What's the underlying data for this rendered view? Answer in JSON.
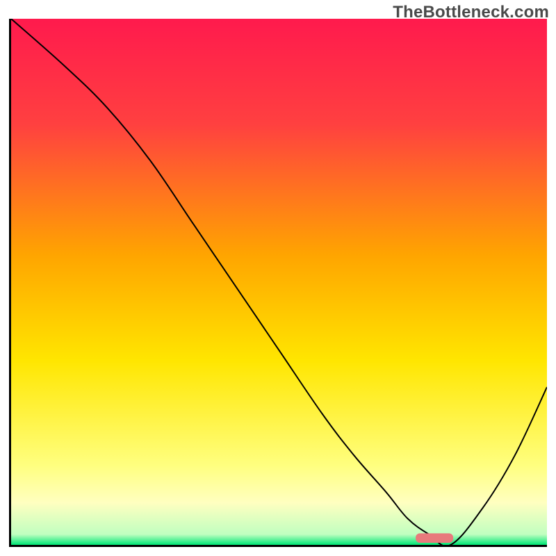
{
  "watermark": "TheBottleneck.com",
  "chart_data": {
    "type": "line",
    "title": "",
    "xlabel": "",
    "ylabel": "",
    "xlim": [
      0,
      100
    ],
    "ylim": [
      0,
      100
    ],
    "grid": false,
    "legend": false,
    "background_gradient_stops": [
      {
        "offset": 0,
        "color": "#ff1a4d"
      },
      {
        "offset": 20,
        "color": "#ff4040"
      },
      {
        "offset": 45,
        "color": "#ffa500"
      },
      {
        "offset": 65,
        "color": "#ffe600"
      },
      {
        "offset": 85,
        "color": "#ffff80"
      },
      {
        "offset": 92,
        "color": "#ffffc0"
      },
      {
        "offset": 98,
        "color": "#c0ffc0"
      },
      {
        "offset": 100,
        "color": "#00e676"
      }
    ],
    "series": [
      {
        "name": "bottleneck-curve",
        "color": "#000000",
        "width": 2,
        "x": [
          0,
          10,
          18,
          26,
          34,
          42,
          50,
          58,
          64,
          70,
          74,
          78,
          82,
          88,
          94,
          100
        ],
        "y": [
          100,
          91,
          83,
          73,
          61,
          49,
          37,
          25,
          17,
          10,
          5,
          2,
          0,
          7,
          17,
          30
        ]
      }
    ],
    "annotations": [
      {
        "name": "optimal-marker",
        "shape": "rounded-bar",
        "x_center": 79,
        "y_center": 1.3,
        "width": 7,
        "height": 1.8,
        "fill": "#e87a7c"
      }
    ]
  }
}
